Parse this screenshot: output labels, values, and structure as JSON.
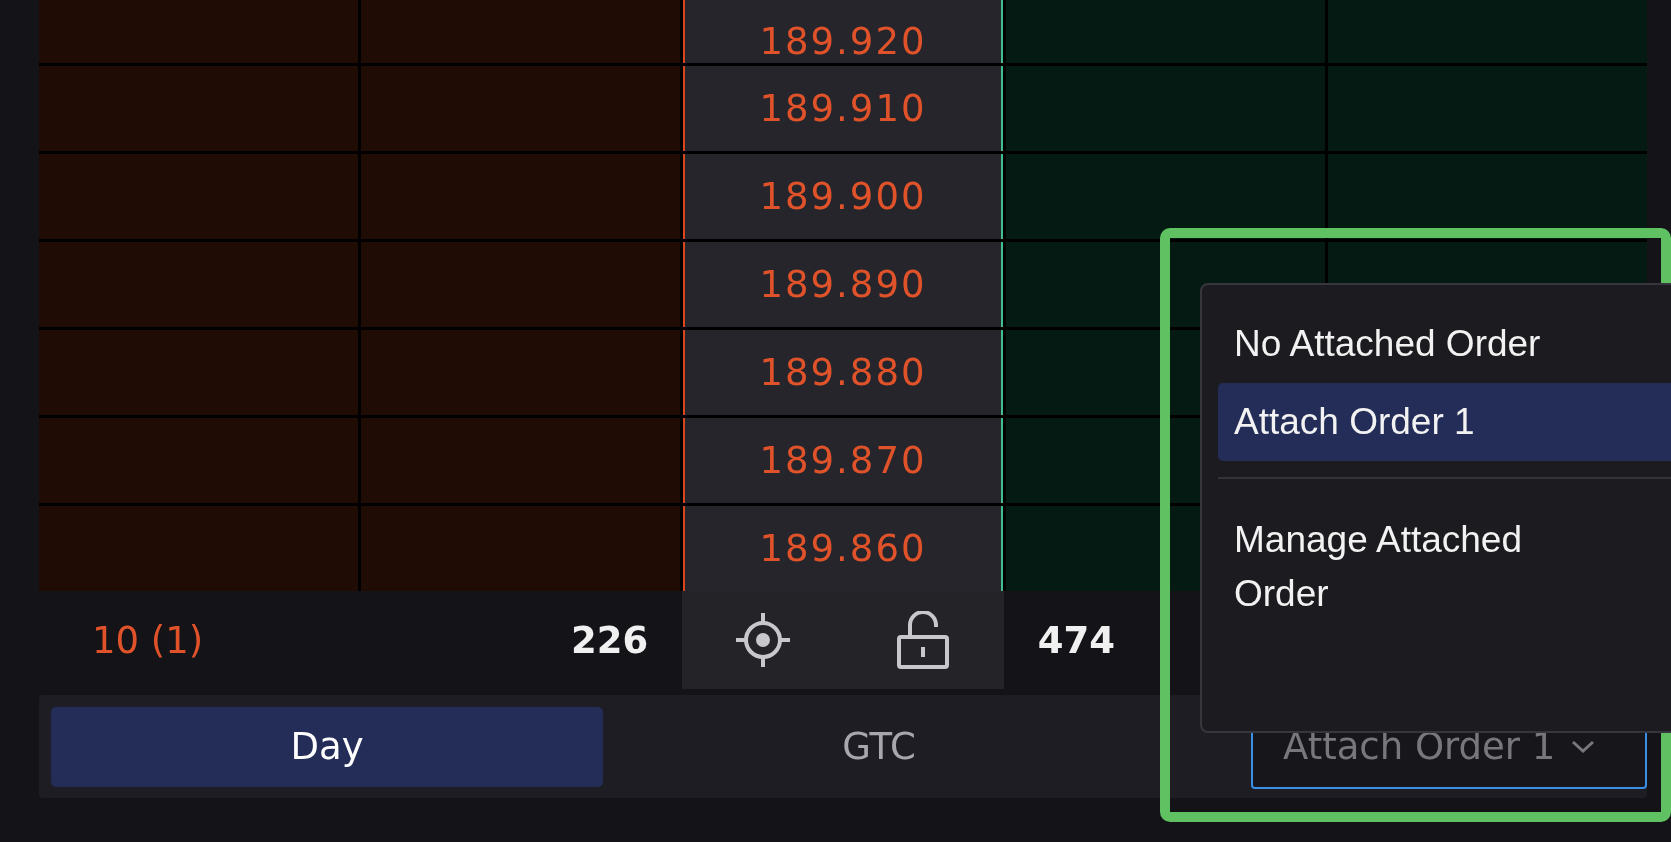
{
  "ladder": {
    "rows": [
      {
        "price": "189.920"
      },
      {
        "price": "189.910"
      },
      {
        "price": "189.900"
      },
      {
        "price": "189.890"
      },
      {
        "price": "189.880"
      },
      {
        "price": "189.870"
      },
      {
        "price": "189.860"
      }
    ]
  },
  "footer": {
    "bid_orders": "10 (1)",
    "bid_size": "226",
    "ask_size": "474"
  },
  "time_in_force": [
    {
      "label": "Day",
      "selected": true
    },
    {
      "label": "GTC",
      "selected": false
    }
  ],
  "attach_select": {
    "value": "Attach Order 1"
  },
  "attach_menu": [
    {
      "label": "No Attached Order",
      "selected": false
    },
    {
      "label": "Attach Order 1",
      "selected": true
    },
    {
      "label": "Manage Attached Order",
      "selected": false
    }
  ]
}
